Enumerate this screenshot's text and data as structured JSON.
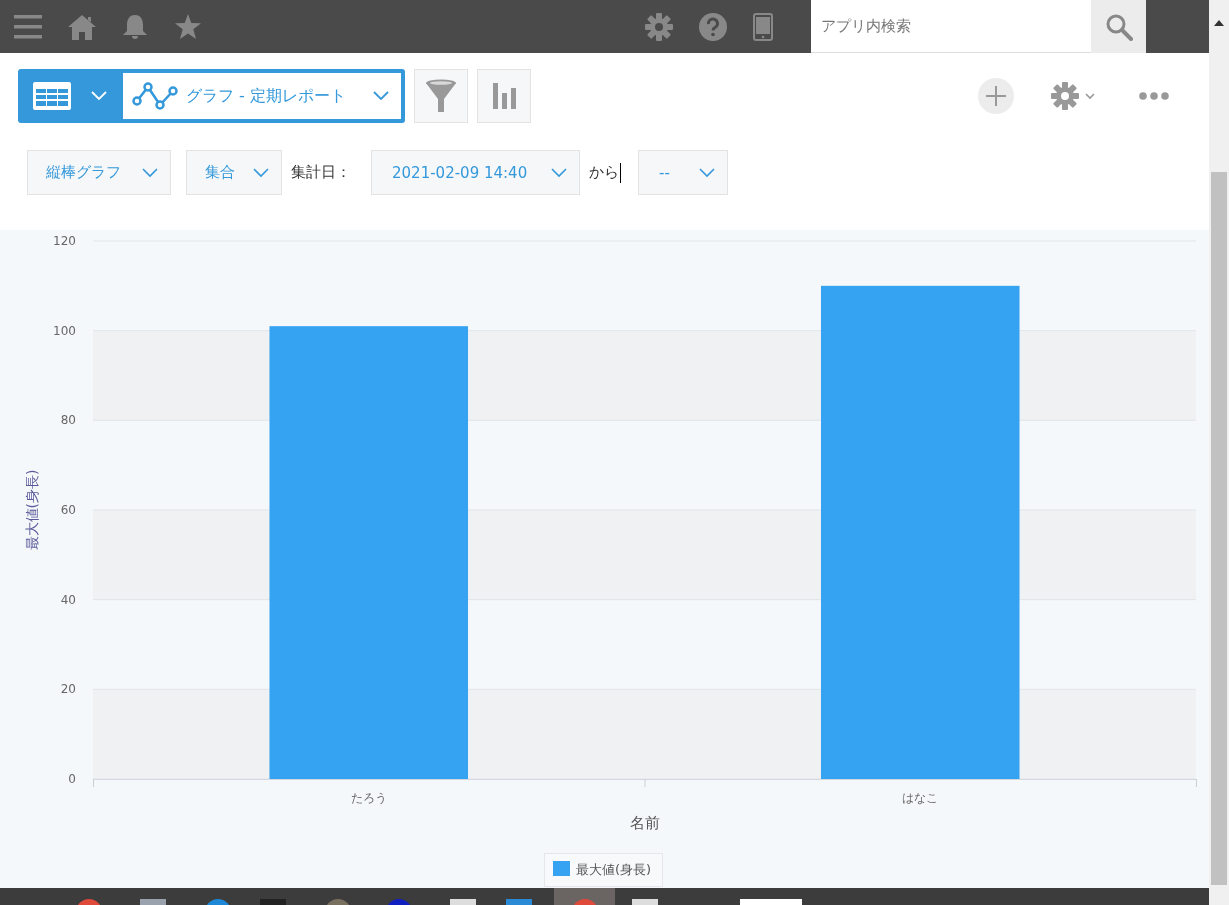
{
  "topbar": {
    "search": {
      "placeholder": "アプリ内検索"
    }
  },
  "toolbar": {
    "view_label": "グラフ - 定期レポート"
  },
  "filters": {
    "chart_type": "縦棒グラフ",
    "grouping": "集合",
    "period_label": "集計日：",
    "period_start": "2021-02-09 14:40",
    "from_label": "から",
    "period_end": "--"
  },
  "chart": {
    "chart_data": {
      "type": "bar",
      "xlabel": "名前",
      "ylabel": "最大値(身長)",
      "categories": [
        "たろう",
        "はなこ"
      ],
      "series": [
        {
          "name": "最大値(身長)",
          "color": "#36a3f2",
          "values": [
            101,
            110
          ]
        }
      ],
      "grid": true,
      "ylim": [
        0,
        120
      ],
      "yticks": [
        0,
        20,
        40,
        60,
        80,
        100,
        120
      ]
    }
  }
}
